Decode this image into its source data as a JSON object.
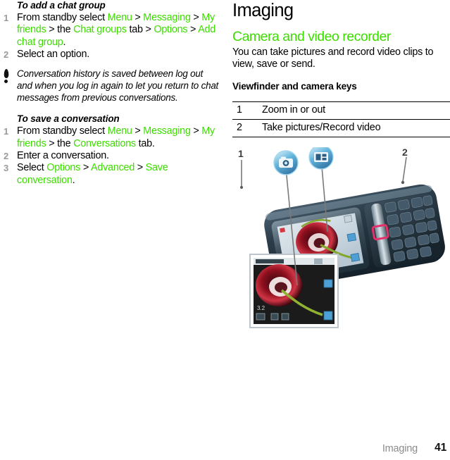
{
  "left_column": {
    "procedure_1": {
      "title": "To add a chat group",
      "steps": [
        {
          "num": "1",
          "parts": [
            {
              "t": "From standby select ",
              "c": "k"
            },
            {
              "t": "Menu",
              "c": "g"
            },
            {
              "t": " > ",
              "c": "k"
            },
            {
              "t": "Messaging",
              "c": "g"
            },
            {
              "t": " > ",
              "c": "k"
            },
            {
              "t": "My friends",
              "c": "g"
            },
            {
              "t": " > the ",
              "c": "k"
            },
            {
              "t": "Chat groups",
              "c": "g"
            },
            {
              "t": " tab > ",
              "c": "k"
            },
            {
              "t": "Options",
              "c": "g"
            },
            {
              "t": " > ",
              "c": "k"
            },
            {
              "t": "Add chat group",
              "c": "g"
            },
            {
              "t": ".",
              "c": "k"
            }
          ]
        },
        {
          "num": "2",
          "parts": [
            {
              "t": "Select an option.",
              "c": "k"
            }
          ]
        }
      ]
    },
    "note": {
      "icon": "exclamation-icon",
      "text": "Conversation history is saved between log out and when you log in again to let you return to chat messages from previous conversations."
    },
    "procedure_2": {
      "title": "To save a conversation",
      "steps": [
        {
          "num": "1",
          "parts": [
            {
              "t": "From standby select ",
              "c": "k"
            },
            {
              "t": "Menu",
              "c": "g"
            },
            {
              "t": " > ",
              "c": "k"
            },
            {
              "t": "Messaging",
              "c": "g"
            },
            {
              "t": " > ",
              "c": "k"
            },
            {
              "t": "My friends",
              "c": "g"
            },
            {
              "t": " > the ",
              "c": "k"
            },
            {
              "t": "Conversations",
              "c": "g"
            },
            {
              "t": " tab.",
              "c": "k"
            }
          ]
        },
        {
          "num": "2",
          "parts": [
            {
              "t": "Enter a conversation.",
              "c": "k"
            }
          ]
        },
        {
          "num": "3",
          "parts": [
            {
              "t": "Select ",
              "c": "k"
            },
            {
              "t": "Options",
              "c": "g"
            },
            {
              "t": " > ",
              "c": "k"
            },
            {
              "t": "Advanced",
              "c": "g"
            },
            {
              "t": " > ",
              "c": "k"
            },
            {
              "t": "Save conversation",
              "c": "g"
            },
            {
              "t": ".",
              "c": "k"
            }
          ]
        }
      ]
    }
  },
  "right_column": {
    "chapter_title": "Imaging",
    "section_title": "Camera and video recorder",
    "body_text": "You can take pictures and record video clips to view, save or send.",
    "sub_title": "Viewfinder and camera keys",
    "keys_table": {
      "rows": [
        {
          "key": "1",
          "desc": "Zoom in or out"
        },
        {
          "key": "2",
          "desc": "Take pictures/Record video"
        }
      ]
    },
    "illustration": {
      "alt": "Mobile phone shown at an angle with camera viewfinder on screen, an enlarged viewfinder inset, two blue badge callouts and numbered leader lines",
      "callout_labels": [
        "1",
        "2"
      ],
      "badges": [
        "camera-badge-icon",
        "video-badge-icon"
      ],
      "highlight_key_color": "#e5316b"
    }
  },
  "footer": {
    "section_name": "Imaging",
    "page_number": "41"
  },
  "colors": {
    "accent_green": "#3ddd00",
    "step_number_gray": "#9a9a9a",
    "footer_gray": "#8c8c8c",
    "rule_black": "#000000"
  }
}
